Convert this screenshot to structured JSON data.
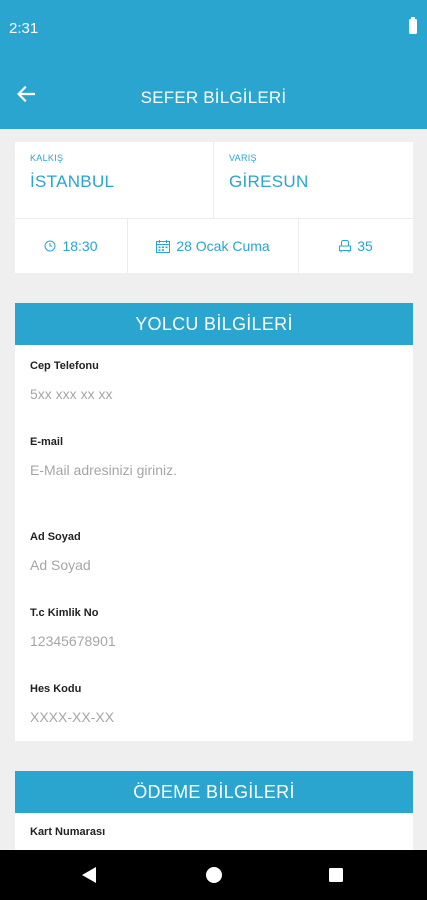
{
  "status_bar": {
    "time": "2:31"
  },
  "app_bar": {
    "title": "SEFER BİLGİLERİ"
  },
  "route": {
    "from_label": "KALKIŞ",
    "from_city": "İSTANBUL",
    "to_label": "VARIŞ",
    "to_city": "GİRESUN",
    "time": "18:30",
    "date": "28 Ocak Cuma",
    "seat": "35"
  },
  "passenger": {
    "title": "YOLCU BİLGİLERİ",
    "fields": [
      {
        "label": "Cep Telefonu",
        "placeholder": "5xx xxx xx xx"
      },
      {
        "label": "E-mail",
        "placeholder": "E-Mail adresinizi giriniz."
      },
      {
        "label": "Ad Soyad",
        "placeholder": "Ad Soyad"
      },
      {
        "label": "T.c Kimlik No",
        "placeholder": "12345678901"
      },
      {
        "label": "Hes Kodu",
        "placeholder": "XXXX-XX-XX"
      }
    ]
  },
  "payment": {
    "title": "ÖDEME BİLGİLERİ",
    "fields": [
      {
        "label": "Kart Numarası"
      }
    ]
  },
  "colors": {
    "primary": "#29a5d0",
    "background": "#efefef"
  }
}
